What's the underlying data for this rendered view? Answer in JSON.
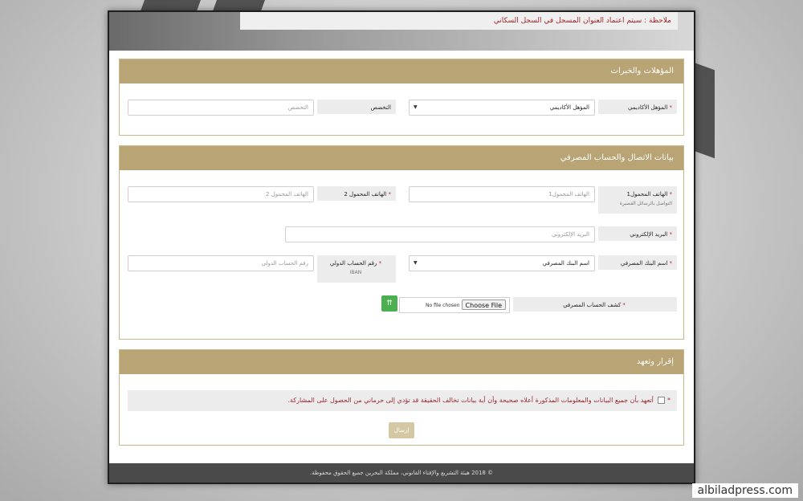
{
  "note": "ملاحظة : سيتم اعتماد العنوان المسجل في السجل السكاني",
  "qualifications": {
    "title": "المؤهلات والخبرات",
    "academic_label": "المؤهل الأكاديمي",
    "academic_value": "المؤهل الأكاديمي",
    "specialty_label": "التخصص",
    "specialty_placeholder": "التخصص"
  },
  "contact": {
    "title": "بيانات الاتصال والحساب المصرفي",
    "mobile1_label": "الهاتف المحمول1",
    "mobile1_sub": "التواصل بالرسائل القصيرة",
    "mobile1_placeholder": "الهاتف المحمول1",
    "mobile2_label": "الهاتف المحمول 2",
    "mobile2_placeholder": "الهاتف المحمول 2",
    "email_label": "البريد الإلكتروني",
    "email_placeholder": "البريد الإلكتروني",
    "bank_label": "اسم البنك المصرفي",
    "bank_value": "اسم البنك المصرفي",
    "iban_label": "رقم الحساب الدولي",
    "iban_sub": "IBAN",
    "iban_placeholder": "رقم الحساب الدولي",
    "statement_label": "كشف الحساب المصرفي",
    "file_status": "No file chosen",
    "choose_file": "Choose File",
    "upload_glyph": "⇈"
  },
  "declaration": {
    "title": "إقرار وتعهد",
    "text": "أتعهد بأن جميع البيانات والمعلومات المذكورة أعلاه صحيحة وأن أية بيانات تخالف الحقيقة قد تؤدي إلى حرماني من الحصول على المشاركة.",
    "submit": "إرسال"
  },
  "footer": "© 2018 هيئة التشريع والإفتاء القانوني، مملكة البحرين جميع الحقوق محفوظة.",
  "required_mark": "*",
  "dropdown_caret": "▼",
  "watermark": "albiladpress.com",
  "colors": {
    "panel_header": "#b8a475",
    "required": "#c0272d",
    "note_text": "#a0262c",
    "upload_button": "#4cb050"
  }
}
